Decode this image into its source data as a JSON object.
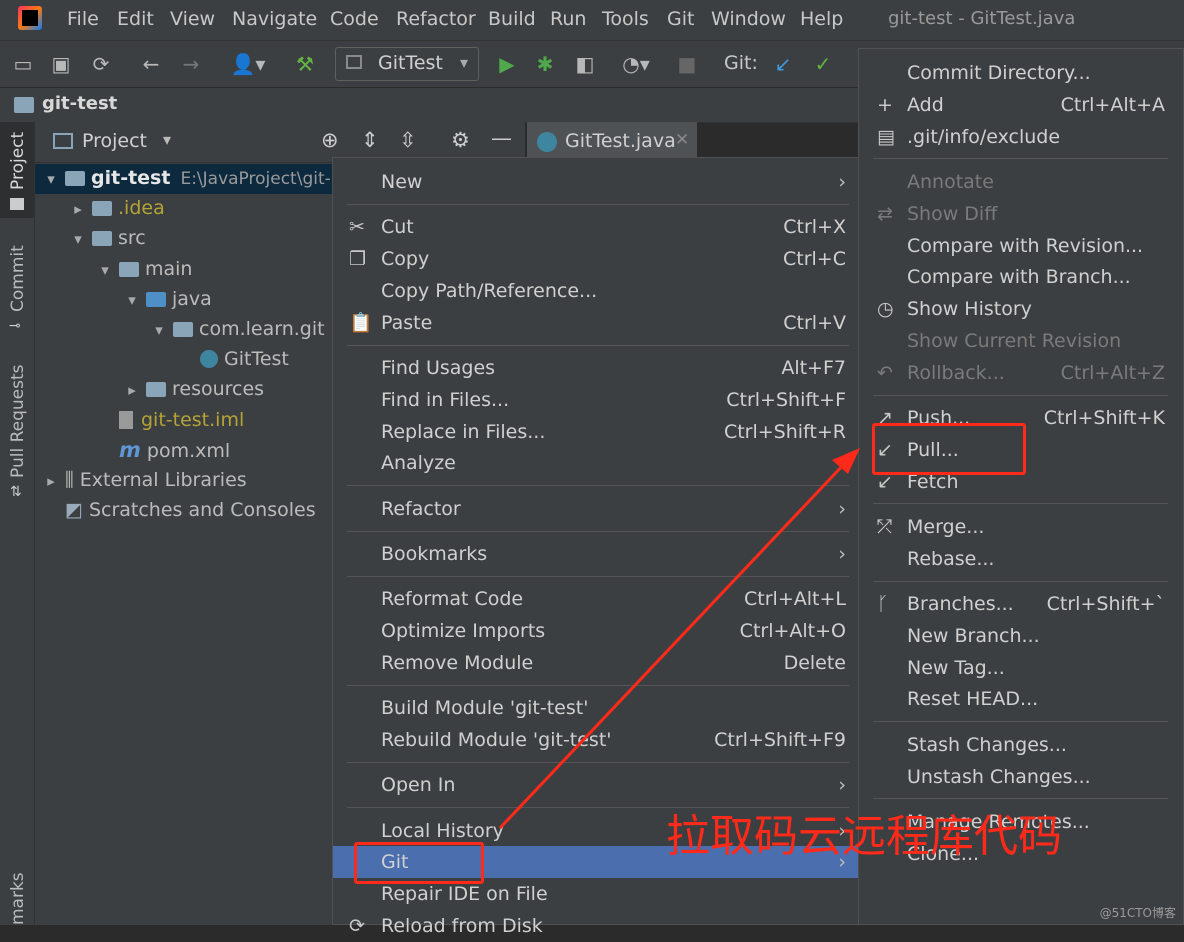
{
  "window_title": "git-test - GitTest.java",
  "menu": [
    "File",
    "Edit",
    "View",
    "Navigate",
    "Code",
    "Refactor",
    "Build",
    "Run",
    "Tools",
    "Git",
    "Window",
    "Help"
  ],
  "toolbar": {
    "run_config": "GitTest",
    "git_label": "Git:"
  },
  "nav": {
    "project": "git-test"
  },
  "left_tools": [
    "Project",
    "Commit",
    "Pull Requests",
    "marks"
  ],
  "project_panel": {
    "title": "Project",
    "tree": [
      {
        "label": "git-test",
        "extra": "E:\\JavaProject\\git-",
        "arrow": "▾",
        "indent": 0,
        "kind": "module",
        "color": "#e6e6e6"
      },
      {
        "label": ".idea",
        "arrow": "▸",
        "indent": 1,
        "kind": "folder",
        "color": "#b5a336"
      },
      {
        "label": "src",
        "arrow": "▾",
        "indent": 1,
        "kind": "folder",
        "color": "#bbbbbb"
      },
      {
        "label": "main",
        "arrow": "▾",
        "indent": 2,
        "kind": "folder",
        "color": "#bbbbbb"
      },
      {
        "label": "java",
        "arrow": "▾",
        "indent": 3,
        "kind": "folder-blue",
        "color": "#bbbbbb"
      },
      {
        "label": "com.learn.git",
        "arrow": "▾",
        "indent": 4,
        "kind": "package",
        "color": "#bbbbbb"
      },
      {
        "label": "GitTest",
        "arrow": "",
        "indent": 5,
        "kind": "class",
        "color": "#bbbbbb"
      },
      {
        "label": "resources",
        "arrow": "▸",
        "indent": 3,
        "kind": "folder",
        "color": "#bbbbbb"
      },
      {
        "label": "git-test.iml",
        "arrow": "",
        "indent": 2,
        "kind": "file",
        "color": "#b5a336"
      },
      {
        "label": "pom.xml",
        "arrow": "",
        "indent": 2,
        "kind": "maven",
        "color": "#bbbbbb"
      },
      {
        "label": "External Libraries",
        "arrow": "▸",
        "indent": 0,
        "kind": "lib",
        "color": "#bbbbbb"
      },
      {
        "label": "Scratches and Consoles",
        "arrow": "",
        "indent": 0,
        "kind": "scratch",
        "color": "#bbbbbb"
      }
    ]
  },
  "editor_tab": "GitTest.java",
  "context_menu": {
    "items": [
      {
        "label": "New",
        "shortcut": "",
        "submenu": true,
        "icon": ""
      },
      {
        "sep": true
      },
      {
        "label": "Cut",
        "shortcut": "Ctrl+X",
        "icon": "✂"
      },
      {
        "label": "Copy",
        "shortcut": "Ctrl+C",
        "icon": "❐"
      },
      {
        "label": "Copy Path/Reference...",
        "shortcut": ""
      },
      {
        "label": "Paste",
        "shortcut": "Ctrl+V",
        "icon": "📋"
      },
      {
        "sep": true
      },
      {
        "label": "Find Usages",
        "shortcut": "Alt+F7"
      },
      {
        "label": "Find in Files...",
        "shortcut": "Ctrl+Shift+F"
      },
      {
        "label": "Replace in Files...",
        "shortcut": "Ctrl+Shift+R"
      },
      {
        "label": "Analyze",
        "submenu": true
      },
      {
        "sep": true
      },
      {
        "label": "Refactor",
        "submenu": true
      },
      {
        "sep": true
      },
      {
        "label": "Bookmarks",
        "submenu": true
      },
      {
        "sep": true
      },
      {
        "label": "Reformat Code",
        "shortcut": "Ctrl+Alt+L"
      },
      {
        "label": "Optimize Imports",
        "shortcut": "Ctrl+Alt+O"
      },
      {
        "label": "Remove Module",
        "shortcut": "Delete"
      },
      {
        "sep": true
      },
      {
        "label": "Build Module 'git-test'",
        "shortcut": ""
      },
      {
        "label": "Rebuild Module 'git-test'",
        "shortcut": "Ctrl+Shift+F9"
      },
      {
        "sep": true
      },
      {
        "label": "Open In",
        "submenu": true
      },
      {
        "sep": true
      },
      {
        "label": "Local History",
        "submenu": true
      },
      {
        "label": "Git",
        "submenu": true,
        "selected": true
      },
      {
        "label": "Repair IDE on File",
        "shortcut": ""
      },
      {
        "label": "Reload from Disk",
        "shortcut": "",
        "icon": "⟳"
      }
    ]
  },
  "git_menu": {
    "items": [
      {
        "label": "Commit Directory...",
        "shortcut": ""
      },
      {
        "label": "Add",
        "shortcut": "Ctrl+Alt+A",
        "icon": "+"
      },
      {
        "label": ".git/info/exclude",
        "shortcut": "",
        "icon": "▤"
      },
      {
        "sep": true
      },
      {
        "label": "Annotate",
        "disabled": true
      },
      {
        "label": "Show Diff",
        "disabled": true,
        "icon": "⇄"
      },
      {
        "label": "Compare with Revision..."
      },
      {
        "label": "Compare with Branch..."
      },
      {
        "label": "Show History",
        "icon": "◷"
      },
      {
        "label": "Show Current Revision",
        "disabled": true
      },
      {
        "label": "Rollback...",
        "shortcut": "Ctrl+Alt+Z",
        "disabled": true,
        "icon": "↶"
      },
      {
        "sep": true
      },
      {
        "label": "Push...",
        "shortcut": "Ctrl+Shift+K",
        "icon": "↗"
      },
      {
        "label": "Pull...",
        "icon": "↙"
      },
      {
        "label": "Fetch",
        "icon": "↙"
      },
      {
        "sep": true
      },
      {
        "label": "Merge...",
        "icon": "⤱"
      },
      {
        "label": "Rebase..."
      },
      {
        "sep": true
      },
      {
        "label": "Branches...",
        "shortcut": "Ctrl+Shift+`",
        "icon": "ᚴ"
      },
      {
        "label": "New Branch..."
      },
      {
        "label": "New Tag..."
      },
      {
        "label": "Reset HEAD..."
      },
      {
        "sep": true
      },
      {
        "label": "Stash Changes..."
      },
      {
        "label": "Unstash Changes..."
      },
      {
        "sep": true
      },
      {
        "label": "Manage Remotes..."
      },
      {
        "label": "Clone..."
      }
    ]
  },
  "annotation": {
    "text": "拉取码云远程库代码",
    "color": "#ff2a1a"
  },
  "watermark": "@51CTO博客"
}
